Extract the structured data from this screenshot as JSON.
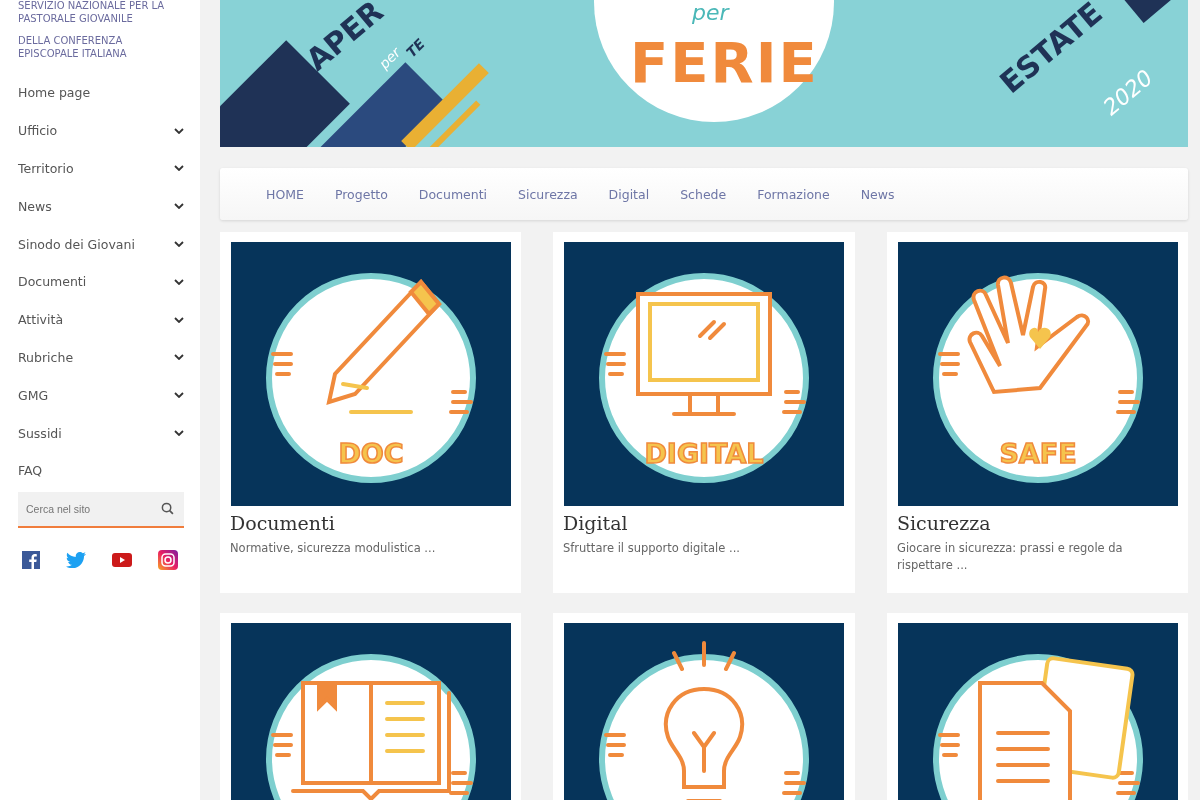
{
  "sidebar": {
    "org_lines": [
      "SERVIZIO NAZIONALE PER LA PASTORALE GIOVANILE",
      "DELLA CONFERENZA EPISCOPALE ITALIANA"
    ],
    "menu": [
      {
        "label": "Home page",
        "expandable": false
      },
      {
        "label": "Ufficio",
        "expandable": true
      },
      {
        "label": "Territorio",
        "expandable": true
      },
      {
        "label": "News",
        "expandable": true
      },
      {
        "label": "Sinodo dei Giovani",
        "expandable": true
      },
      {
        "label": "Documenti",
        "expandable": true
      },
      {
        "label": "Attività",
        "expandable": true
      },
      {
        "label": "Rubriche",
        "expandable": true
      },
      {
        "label": "GMG",
        "expandable": true
      },
      {
        "label": "Sussidi",
        "expandable": true
      },
      {
        "label": "FAQ",
        "expandable": false
      }
    ],
    "search": {
      "placeholder": "Cerca nel sito"
    }
  },
  "banner": {
    "left_word": "APER",
    "left_small": "per",
    "left_accent": "TE",
    "center_small": "per",
    "center_word": "FERIE",
    "right_word": "ESTATE",
    "right_year": "2020"
  },
  "nav": [
    "HOME",
    "Progetto",
    "Documenti",
    "Sicurezza",
    "Digital",
    "Schede",
    "Formazione",
    "News"
  ],
  "cards": [
    {
      "kind": "pencil",
      "badge": "DOC",
      "title": "Documenti",
      "description": "Normative, sicurezza modulistica ..."
    },
    {
      "kind": "monitor",
      "badge": "DIGITAL",
      "title": "Digital",
      "description": "Sfruttare il supporto digitale ..."
    },
    {
      "kind": "hand",
      "badge": "SAFE",
      "title": "Sicurezza",
      "description": "Giocare in sicurezza: prassi e regole da rispettare ..."
    },
    {
      "kind": "book"
    },
    {
      "kind": "bulb"
    },
    {
      "kind": "papers"
    }
  ]
}
